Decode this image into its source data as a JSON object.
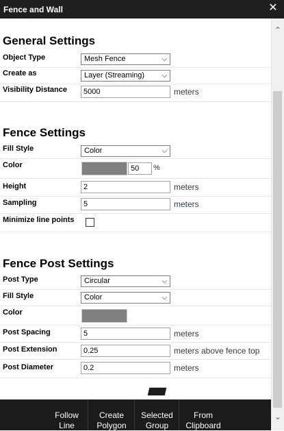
{
  "window": {
    "title": "Fence and Wall",
    "close": "✕"
  },
  "general": {
    "title": "General Settings",
    "object_type_label": "Object Type",
    "object_type_value": "Mesh Fence",
    "create_as_label": "Create as",
    "create_as_value": "Layer (Streaming)",
    "visibility_label": "Visibility Distance",
    "visibility_value": "5000",
    "visibility_unit": "meters"
  },
  "fence": {
    "title": "Fence Settings",
    "fill_style_label": "Fill Style",
    "fill_style_value": "Color",
    "color_label": "Color",
    "color_swatch": "#808080",
    "opacity_value": "50",
    "opacity_unit": "%",
    "height_label": "Height",
    "height_value": "2",
    "height_unit": "meters",
    "sampling_label": "Sampling",
    "sampling_value": "5",
    "sampling_unit": "meters",
    "minimize_label": "Minimize line points",
    "minimize_checked": false
  },
  "post": {
    "title": "Fence Post Settings",
    "post_type_label": "Post Type",
    "post_type_value": "Circular",
    "fill_style_label": "Fill Style",
    "fill_style_value": "Color",
    "color_label": "Color",
    "color_swatch": "#808080",
    "spacing_label": "Post Spacing",
    "spacing_value": "5",
    "spacing_unit": "meters",
    "extension_label": "Post Extension",
    "extension_value": "0.25",
    "extension_unit": "meters above fence top",
    "diameter_label": "Post Diameter",
    "diameter_value": "0.2",
    "diameter_unit": "meters"
  },
  "toolbar": {
    "follow_line_1": "Follow",
    "follow_line_2": "Line",
    "create_polygon_1": "Create",
    "create_polygon_2": "Polygon",
    "selected_group_1": "Selected",
    "selected_group_2": "Group",
    "from_clipboard_1": "From",
    "from_clipboard_2": "Clipboard"
  }
}
